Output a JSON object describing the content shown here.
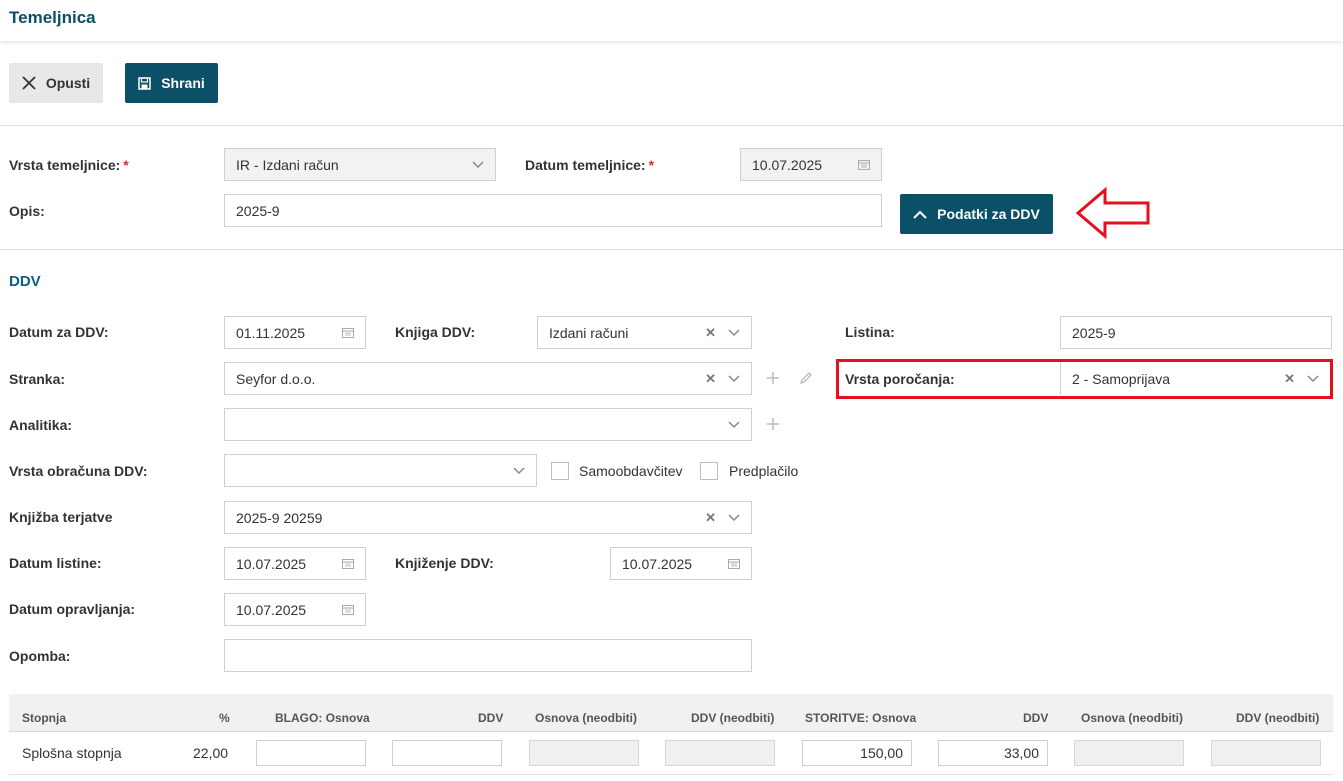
{
  "header": {
    "title": "Temeljnica"
  },
  "toolbar": {
    "cancel_label": "Opusti",
    "save_label": "Shrani"
  },
  "form": {
    "vrsta_label": "Vrsta temeljnice:",
    "vrsta_value": "IR - Izdani račun",
    "datum_label": "Datum temeljnice:",
    "datum_value": "10.07.2025",
    "opis_label": "Opis:",
    "opis_value": "2025-9",
    "ddv_button_label": "Podatki za DDV",
    "required_mark": "*"
  },
  "ddv": {
    "section_title": "DDV",
    "datum_za_ddv_label": "Datum za DDV:",
    "datum_za_ddv_value": "01.11.2025",
    "knjiga_label": "Knjiga DDV:",
    "knjiga_value": "Izdani računi",
    "listina_label": "Listina:",
    "listina_value": "2025-9",
    "stranka_label": "Stranka:",
    "stranka_value": "Seyfor d.o.o.",
    "vrsta_porocanja_label": "Vrsta poročanja:",
    "vrsta_porocanja_value": "2 - Samoprijava",
    "analitika_label": "Analitika:",
    "analitika_value": "",
    "vrsta_obracuna_label": "Vrsta obračuna DDV:",
    "vrsta_obracuna_value": "",
    "samoobdavcitev_label": "Samoobdavčitev",
    "predplacilo_label": "Predplačilo",
    "knjizba_label": "Knjižba terjatve",
    "knjizba_value": "2025-9 20259",
    "datum_listine_label": "Datum listine:",
    "datum_listine_value": "10.07.2025",
    "knjizenje_label": "Knjiženje DDV:",
    "knjizenje_value": "10.07.2025",
    "datum_opravljanja_label": "Datum opravljanja:",
    "datum_opravljanja_value": "10.07.2025",
    "opomba_label": "Opomba:",
    "opomba_value": ""
  },
  "table": {
    "columns": [
      "Stopnja",
      "%",
      "BLAGO: Osnova",
      "DDV",
      "Osnova (neodbiti)",
      "DDV (neodbiti)",
      "STORITVE: Osnova",
      "DDV",
      "Osnova (neodbiti)",
      "DDV (neodbiti)"
    ],
    "rows": [
      {
        "stopnja": "Splošna stopnja",
        "pct": "22,00",
        "blago_osnova": "",
        "blago_ddv": "",
        "blago_osnova_neodbiti": "",
        "blago_ddv_neodbiti": "",
        "storitve_osnova": "150,00",
        "storitve_ddv": "33,00",
        "storitve_osnova_neodbiti": "",
        "storitve_ddv_neodbiti": ""
      }
    ]
  },
  "colors": {
    "brand": "#0c5068",
    "highlight": "#e3101e",
    "required": "#d32f2f"
  },
  "icons": [
    "close-icon",
    "save-icon",
    "chevron-up-icon",
    "chevron-down-icon",
    "calendar-icon",
    "clear-icon",
    "plus-icon",
    "pencil-icon",
    "arrow-left-annotation"
  ]
}
